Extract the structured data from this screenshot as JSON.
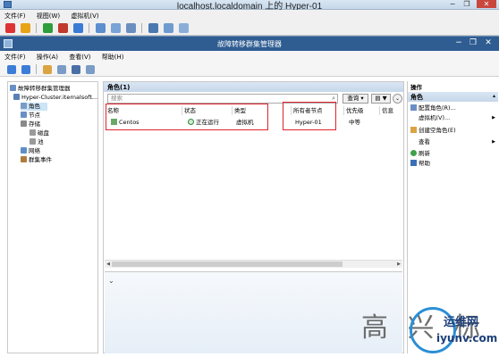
{
  "vm_window": {
    "title": "localhost.localdomain 上的 Hyper-01",
    "menu": [
      "文件(F)",
      "视图(W)",
      "虚拟机(V)"
    ],
    "controls": {
      "minimize": "−",
      "restore": "❐",
      "close": "✕"
    }
  },
  "mmc_window": {
    "title": "故障转移群集管理器",
    "menu": [
      "文件(F)",
      "操作(A)",
      "查看(V)",
      "帮助(H)"
    ],
    "controls": {
      "minimize": "−",
      "restore": "❐",
      "close": "✕"
    }
  },
  "tree": {
    "root": "故障转移群集管理器",
    "cluster": "Hyper-Cluster.iternalsoft...",
    "items": [
      "角色",
      "节点",
      "存储",
      "磁盘",
      "池",
      "网络",
      "群集事件"
    ]
  },
  "center": {
    "header": "角色(1)",
    "search_placeholder": "搜索",
    "query_label": "查询",
    "save_label": "▼",
    "columns": [
      "名称",
      "状态",
      "类型",
      "所有者节点",
      "优先级",
      "信息"
    ],
    "rows": [
      {
        "name": "Centos",
        "status": "正在运行",
        "type": "虚拟机",
        "owner": "Hyper-01",
        "priority": "中等",
        "info": ""
      }
    ]
  },
  "actions": {
    "header": "操作",
    "subheader": "角色",
    "items": [
      "配置角色(R)...",
      "虚拟机(V)...",
      "创建空角色(E)",
      "查看",
      "刷新",
      "帮助"
    ]
  },
  "watermark": {
    "text": "高 兴 标",
    "cn": "运维网",
    "url": "iyunv.com"
  },
  "colors": {
    "mmc_title": "#2f5d92",
    "selection": "#cce4f7",
    "highlight_box": "#e0232c"
  }
}
